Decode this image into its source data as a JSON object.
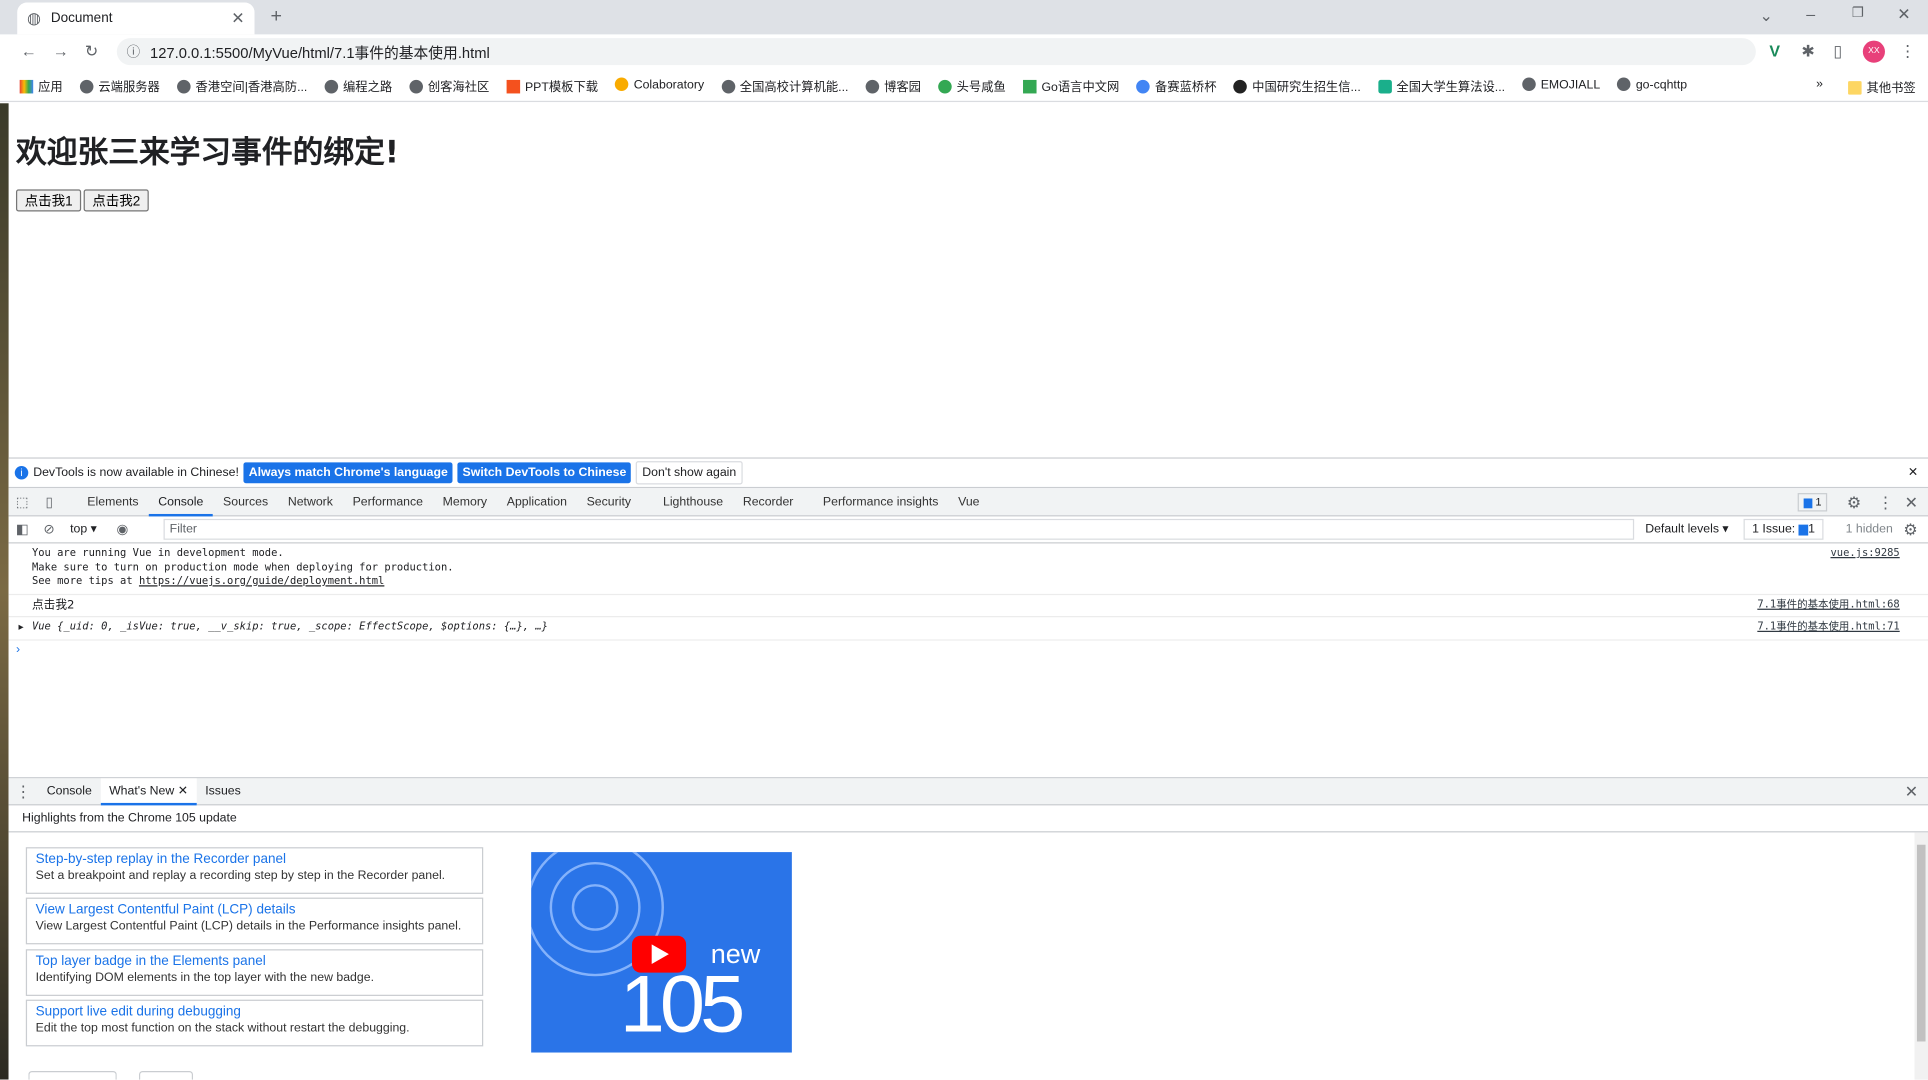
{
  "browser": {
    "tab_title": "Document",
    "url": "127.0.0.1:5500/MyVue/html/7.1事件的基本使用.html",
    "profile": "XX",
    "bookmarks": [
      "应用",
      "云端服务器",
      "香港空间|香港高防...",
      "编程之路",
      "创客海社区",
      "PPT模板下载",
      "Colaboratory",
      "全国高校计算机能...",
      "博客园",
      "头号咸鱼",
      "Go语言中文网",
      "备赛蓝桥杯",
      "中国研究生招生信...",
      "全国大学生算法设...",
      "EMOJIALL",
      "go-cqhttp"
    ],
    "other_bookmarks": "其他书签"
  },
  "page": {
    "heading": "欢迎张三来学习事件的绑定!",
    "button1": "点击我1",
    "button2": "点击我2"
  },
  "devtools": {
    "infobar": {
      "text": "DevTools is now available in Chinese!",
      "btn1": "Always match Chrome's language",
      "btn2": "Switch DevTools to Chinese",
      "btn3": "Don't show again"
    },
    "tabs": [
      "Elements",
      "Console",
      "Sources",
      "Network",
      "Performance",
      "Memory",
      "Application",
      "Security",
      "Lighthouse",
      "Recorder",
      "Performance insights",
      "Vue"
    ],
    "active_tab": "Console",
    "issues_badge": "1",
    "console_toolbar": {
      "context": "top",
      "filter_placeholder": "Filter",
      "levels": "Default levels",
      "issues": "1 Issue:",
      "issues_count": "1",
      "hidden": "1 hidden"
    },
    "messages": [
      {
        "lines": [
          "You are running Vue in development mode.",
          "Make sure to turn on production mode when deploying for production.",
          "See more tips at "
        ],
        "link": "https://vuejs.org/guide/deployment.html",
        "source": "vue.js:9285"
      },
      {
        "lines": [
          "点击我2"
        ],
        "source": "7.1事件的基本使用.html:68"
      },
      {
        "lines": [
          "Vue {_uid: 0, _isVue: true, __v_skip: true, _scope: EffectScope, $options: {…}, …}"
        ],
        "source": "7.1事件的基本使用.html:71"
      }
    ],
    "drawer": {
      "tabs": [
        "Console",
        "What's New",
        "Issues"
      ],
      "active": "What's New",
      "header": "Highlights from the Chrome 105 update",
      "cards": [
        {
          "title": "Step-by-step replay in the Recorder panel",
          "desc": "Set a breakpoint and replay a recording step by step in the Recorder panel."
        },
        {
          "title": "View Largest Contentful Paint (LCP) details",
          "desc": "View Largest Contentful Paint (LCP) details in the Performance insights panel."
        },
        {
          "title": "Top layer badge in the Elements panel",
          "desc": "Identifying DOM elements in the top layer with the new badge."
        },
        {
          "title": "Support live edit during debugging",
          "desc": "Edit the top most function on the stack without restart the debugging."
        }
      ],
      "video": {
        "new": "new",
        "version": "105"
      }
    }
  }
}
